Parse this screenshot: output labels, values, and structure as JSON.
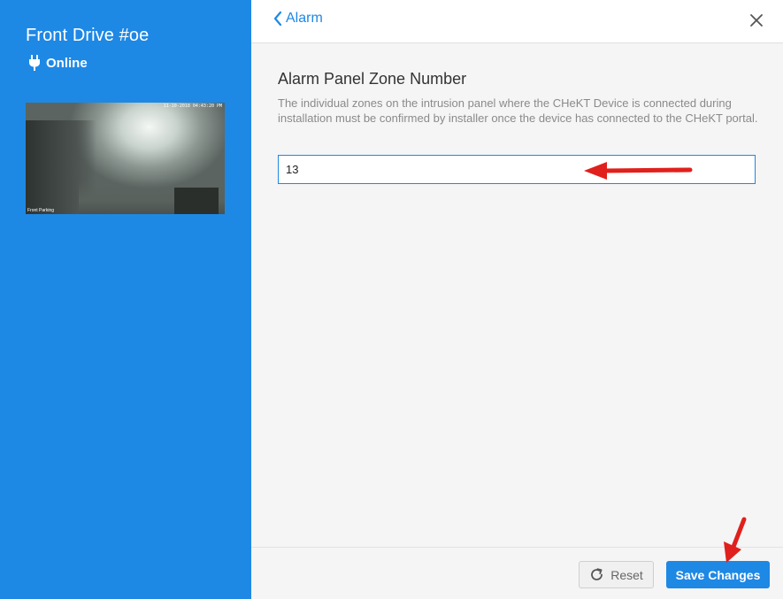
{
  "sidebar": {
    "device_name": "Front Drive #oe",
    "status": "Online",
    "camera": {
      "timestamp": "11-10-2018 04:43:20 PM",
      "label": "Front Parking"
    }
  },
  "header": {
    "back_label": "Alarm"
  },
  "field": {
    "title": "Alarm Panel Zone Number",
    "description": "The individual zones on the intrusion panel where the CHeKT Device is connected during installation must be confirmed by installer once the device has connected to the CHeKT portal.",
    "value": "13"
  },
  "footer": {
    "reset_label": "Reset",
    "save_label": "Save Changes"
  },
  "colors": {
    "brand_blue": "#1e88e5",
    "annotation_red": "#e0201c"
  }
}
